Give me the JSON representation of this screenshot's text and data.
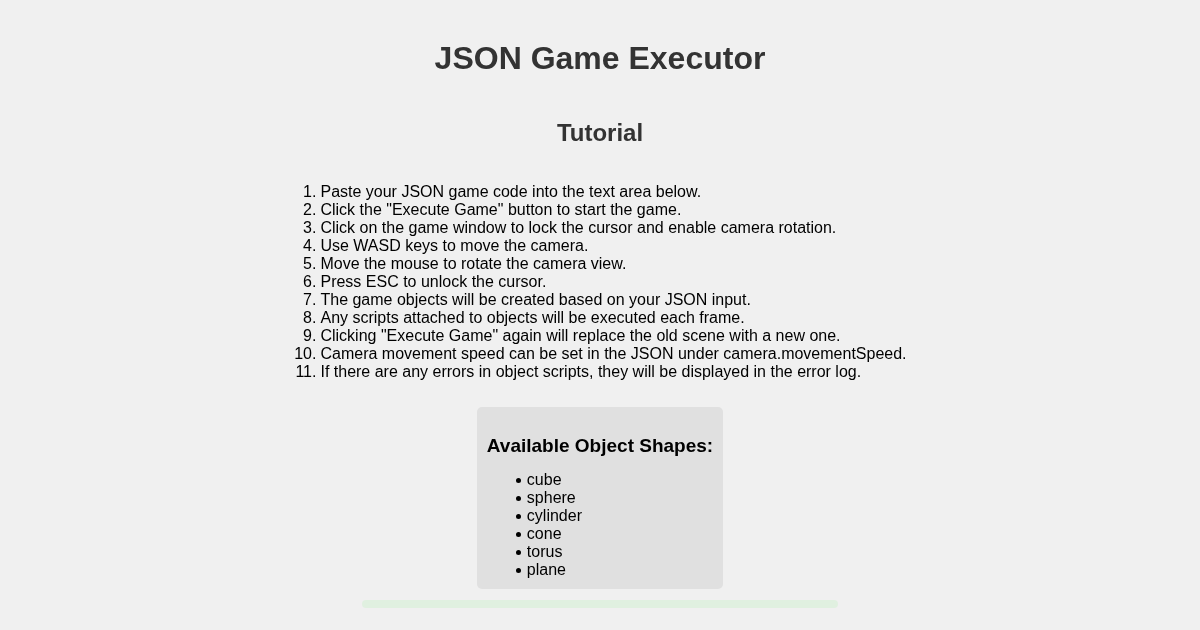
{
  "title": "JSON Game Executor",
  "tutorial": {
    "heading": "Tutorial",
    "steps": [
      {
        "number": "1.",
        "text": "Paste your JSON game code into the text area below."
      },
      {
        "number": "2.",
        "text": "Click the \"Execute Game\" button to start the game."
      },
      {
        "number": "3.",
        "text": "Click on the game window to lock the cursor and enable camera rotation."
      },
      {
        "number": "4.",
        "text": "Use WASD keys to move the camera."
      },
      {
        "number": "5.",
        "text": "Move the mouse to rotate the camera view."
      },
      {
        "number": "6.",
        "text": "Press ESC to unlock the cursor."
      },
      {
        "number": "7.",
        "text": "The game objects will be created based on your JSON input."
      },
      {
        "number": "8.",
        "text": "Any scripts attached to objects will be executed each frame."
      },
      {
        "number": "9.",
        "text": "Clicking \"Execute Game\" again will replace the old scene with a new one."
      },
      {
        "number": "10.",
        "text": "Camera movement speed can be set in the JSON under camera.movementSpeed."
      },
      {
        "number": "11.",
        "text": "If there are any errors in object scripts, they will be displayed in the error log."
      }
    ]
  },
  "shapes": {
    "heading": "Available Object Shapes:",
    "items": [
      "cube",
      "sphere",
      "cylinder",
      "cone",
      "torus",
      "plane"
    ]
  }
}
